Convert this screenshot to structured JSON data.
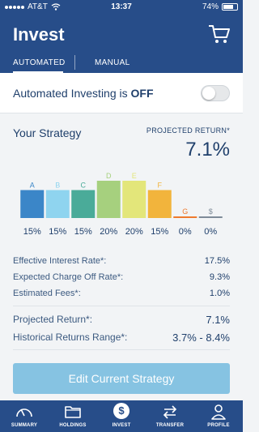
{
  "status_bar": {
    "carrier": "AT&T",
    "time": "13:37",
    "battery": "74%",
    "battery_level": 0.74
  },
  "header": {
    "title": "Invest",
    "cart_icon": "cart-icon"
  },
  "tabs": [
    {
      "label": "AUTOMATED",
      "active": true
    },
    {
      "label": "MANUAL",
      "active": false
    }
  ],
  "automated": {
    "label": "Automated Investing is ",
    "state": "OFF",
    "enabled": false
  },
  "strategy": {
    "title": "Your Strategy",
    "projected_label": "PROJECTED RETURN*",
    "projected_value": "7.1%"
  },
  "chart_data": {
    "type": "bar",
    "categories": [
      "A",
      "B",
      "C",
      "D",
      "E",
      "F",
      "G",
      "$"
    ],
    "values": [
      15,
      15,
      15,
      20,
      20,
      15,
      0,
      0
    ],
    "value_labels": [
      "15%",
      "15%",
      "15%",
      "20%",
      "20%",
      "15%",
      "0%",
      "0%"
    ],
    "colors": [
      "#3b86c8",
      "#8fd4ef",
      "#4aab99",
      "#a6d07e",
      "#e3e67a",
      "#f2b43c",
      "#ee7a2e",
      "#7e8b98"
    ],
    "ylim": [
      0,
      20
    ]
  },
  "rates": [
    {
      "label": "Effective Interest Rate*:",
      "value": "17.5%"
    },
    {
      "label": "Expected Charge Off Rate*:",
      "value": "9.3%"
    },
    {
      "label": "Estimated Fees*:",
      "value": "1.0%"
    }
  ],
  "returns": [
    {
      "label": "Projected Return*:",
      "value": "7.1%"
    },
    {
      "label": "Historical Returns Range*:",
      "value": "3.7% - 8.4%"
    }
  ],
  "edit_button": "Edit Current Strategy",
  "tabbar": [
    {
      "label": "SUMMARY",
      "icon": "gauge-icon"
    },
    {
      "label": "HOLDINGS",
      "icon": "folder-icon"
    },
    {
      "label": "INVEST",
      "icon": "dollar-icon",
      "active": true
    },
    {
      "label": "TRANSFER",
      "icon": "transfer-icon"
    },
    {
      "label": "PROFILE",
      "icon": "person-icon"
    }
  ]
}
